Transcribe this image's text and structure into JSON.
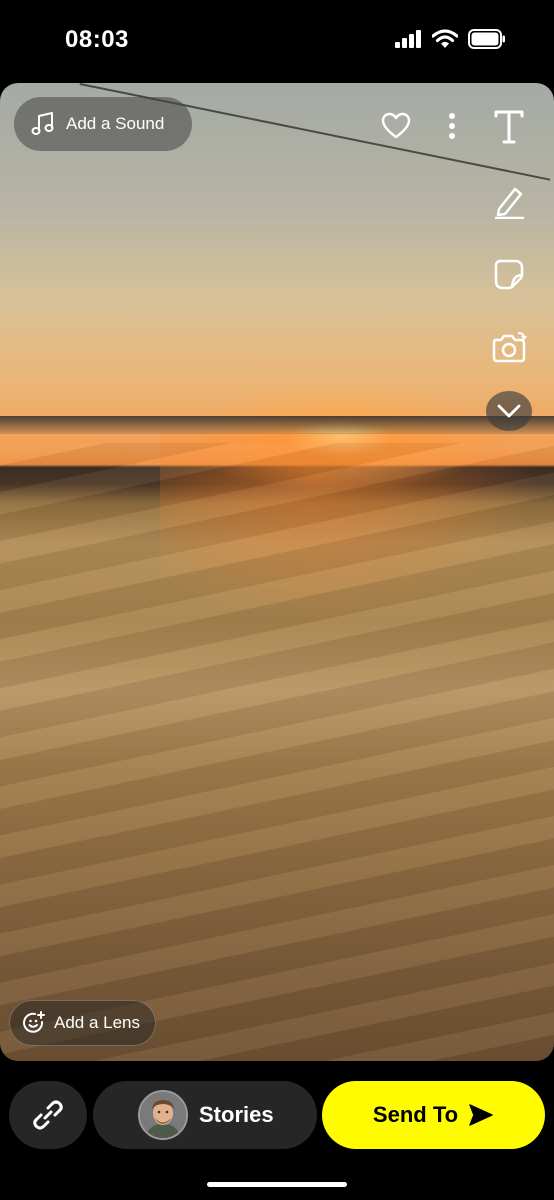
{
  "status_bar": {
    "time": "08:03",
    "icons": [
      "cellular-signal-icon",
      "wifi-icon",
      "battery-icon"
    ]
  },
  "snap": {
    "add_sound_label": "Add a Sound",
    "add_lens_label": "Add a Lens",
    "toolbar_icons": [
      "heart-icon",
      "more-icon",
      "text-icon",
      "pencil-icon",
      "sticker-icon",
      "camera-icon",
      "chevron-down-icon"
    ]
  },
  "bottom_bar": {
    "stories_label": "Stories",
    "send_label": "Send To"
  },
  "colors": {
    "send_button": "#fffc00",
    "dark_button": "#262626"
  }
}
